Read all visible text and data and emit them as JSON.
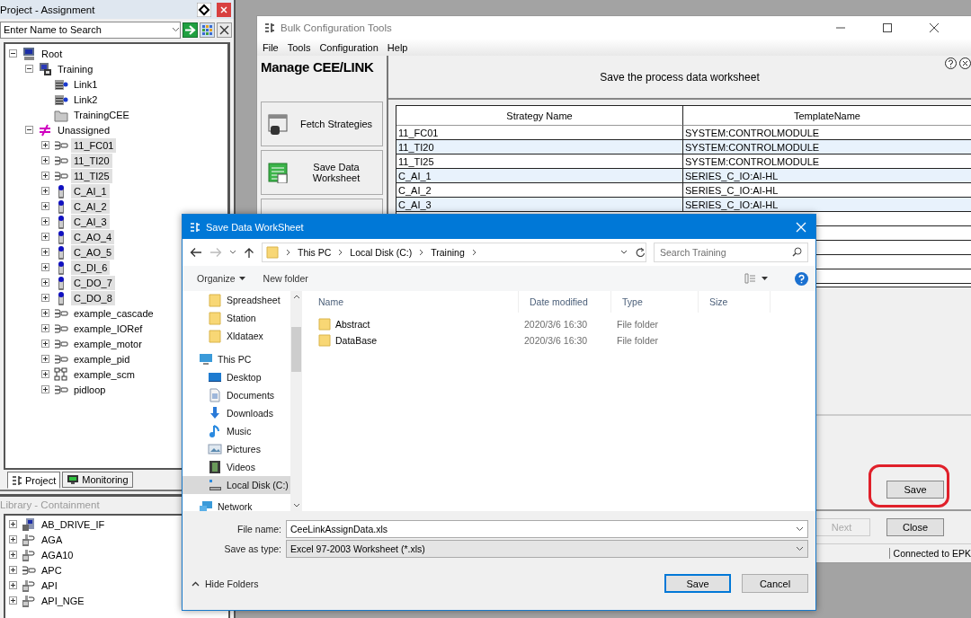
{
  "project_panel": {
    "title": "Project - Assignment",
    "search": {
      "value": "Enter Name to Search"
    },
    "tree": [
      {
        "label": "Root",
        "kind": "computer",
        "expanded": true,
        "selected": false,
        "children": [
          {
            "label": "Training",
            "kind": "controller",
            "expanded": true,
            "selected": false,
            "children": [
              {
                "label": "Link1",
                "kind": "link",
                "selected": false
              },
              {
                "label": "Link2",
                "kind": "link",
                "selected": false
              },
              {
                "label": "TrainingCEE",
                "kind": "folder",
                "selected": false
              }
            ]
          },
          {
            "label": "Unassigned",
            "kind": "unassigned",
            "expanded": true,
            "selected": false,
            "children": [
              {
                "label": "11_FC01",
                "kind": "module",
                "expanded": false,
                "selected": true
              },
              {
                "label": "11_TI20",
                "kind": "module",
                "expanded": false,
                "selected": true
              },
              {
                "label": "11_TI25",
                "kind": "module",
                "expanded": false,
                "selected": true
              },
              {
                "label": "C_AI_1",
                "kind": "io",
                "expanded": false,
                "selected": true
              },
              {
                "label": "C_AI_2",
                "kind": "io",
                "expanded": false,
                "selected": true
              },
              {
                "label": "C_AI_3",
                "kind": "io",
                "expanded": false,
                "selected": true
              },
              {
                "label": "C_AO_4",
                "kind": "io",
                "expanded": false,
                "selected": true
              },
              {
                "label": "C_AO_5",
                "kind": "io",
                "expanded": false,
                "selected": true
              },
              {
                "label": "C_DI_6",
                "kind": "io",
                "expanded": false,
                "selected": true
              },
              {
                "label": "C_DO_7",
                "kind": "io",
                "expanded": false,
                "selected": true
              },
              {
                "label": "C_DO_8",
                "kind": "io",
                "expanded": false,
                "selected": true
              },
              {
                "label": "example_cascade",
                "kind": "module",
                "expanded": false,
                "selected": false
              },
              {
                "label": "example_IORef",
                "kind": "module",
                "expanded": false,
                "selected": false
              },
              {
                "label": "example_motor",
                "kind": "module",
                "expanded": false,
                "selected": false
              },
              {
                "label": "example_pid",
                "kind": "module",
                "expanded": false,
                "selected": false
              },
              {
                "label": "example_scm",
                "kind": "scm",
                "expanded": false,
                "selected": false
              },
              {
                "label": "pidloop",
                "kind": "module",
                "expanded": false,
                "selected": false
              }
            ]
          }
        ]
      }
    ],
    "tabs": [
      {
        "label": "Project",
        "selected": true
      },
      {
        "label": "Monitoring",
        "selected": false
      }
    ]
  },
  "library_panel": {
    "title": "Library - Containment",
    "tree": [
      {
        "label": "AB_DRIVE_IF",
        "kind": "drive",
        "expanded": false,
        "selected": false
      },
      {
        "label": "AGA",
        "kind": "device",
        "expanded": false,
        "selected": false
      },
      {
        "label": "AGA10",
        "kind": "device",
        "expanded": false,
        "selected": false
      },
      {
        "label": "APC",
        "kind": "module",
        "expanded": false,
        "selected": false
      },
      {
        "label": "API",
        "kind": "device",
        "expanded": false,
        "selected": false
      },
      {
        "label": "API_NGE",
        "kind": "device",
        "expanded": false,
        "selected": false
      }
    ]
  },
  "bulk_window": {
    "title": "Bulk Configuration Tools",
    "menu": [
      "File",
      "Tools",
      "Configuration",
      "Help"
    ],
    "heading": "Manage CEE/LINK",
    "steps": [
      {
        "label": "Fetch Strategies",
        "kind": "fetch"
      },
      {
        "label": "Save Data Worksheet",
        "kind": "save"
      }
    ],
    "instruction": "Save the process data worksheet",
    "table": {
      "columns": [
        "Strategy Name",
        "TemplateName"
      ],
      "rows": [
        [
          "11_FC01",
          "SYSTEM:CONTROLMODULE"
        ],
        [
          "11_TI20",
          "SYSTEM:CONTROLMODULE"
        ],
        [
          "11_TI25",
          "SYSTEM:CONTROLMODULE"
        ],
        [
          "C_AI_1",
          "SERIES_C_IO:AI-HL"
        ],
        [
          "C_AI_2",
          "SERIES_C_IO:AI-HL"
        ],
        [
          "C_AI_3",
          "SERIES_C_IO:AI-HL"
        ]
      ]
    },
    "action_button": "Save",
    "buttons": [
      {
        "label": "Next",
        "disabled": true
      },
      {
        "label": "Close",
        "disabled": false
      }
    ],
    "status": "Connected to EPK"
  },
  "save_dialog": {
    "title": "Save Data WorkSheet",
    "breadcrumb": [
      "This PC",
      "Local Disk (C:)",
      "Training"
    ],
    "search": {
      "placeholder": "Search Training"
    },
    "toolbar": [
      "Organize",
      "New folder"
    ],
    "nav_pinned": [
      {
        "label": "Spreadsheet",
        "kind": "folder",
        "selected": false
      },
      {
        "label": "Station",
        "kind": "folder",
        "selected": false
      },
      {
        "label": "Xldataex",
        "kind": "folder",
        "selected": false
      }
    ],
    "nav": [
      {
        "label": "This PC",
        "kind": "pc",
        "selected": false,
        "children": [
          {
            "label": "Desktop",
            "kind": "desktop",
            "selected": false
          },
          {
            "label": "Documents",
            "kind": "documents",
            "selected": false
          },
          {
            "label": "Downloads",
            "kind": "downloads",
            "selected": false
          },
          {
            "label": "Music",
            "kind": "music",
            "selected": false
          },
          {
            "label": "Pictures",
            "kind": "pictures",
            "selected": false
          },
          {
            "label": "Videos",
            "kind": "videos",
            "selected": false
          },
          {
            "label": "Local Disk (C:)",
            "kind": "disk",
            "selected": true
          }
        ]
      },
      {
        "label": "Network",
        "kind": "network",
        "selected": false
      }
    ],
    "columns": [
      "Name",
      "Date modified",
      "Type",
      "Size"
    ],
    "files": [
      {
        "name": "Abstract",
        "date": "2020/3/6 16:30",
        "type": "File folder"
      },
      {
        "name": "DataBase",
        "date": "2020/3/6 16:30",
        "type": "File folder"
      }
    ],
    "file_name": {
      "label": "File name:",
      "value": "CeeLinkAssignData.xls"
    },
    "save_type": {
      "label": "Save as type:",
      "value": "Excel 97-2003 Worksheet (*.xls)"
    },
    "hide_folders": "Hide Folders",
    "buttons": [
      {
        "label": "Save",
        "default": true
      },
      {
        "label": "Cancel",
        "default": false
      }
    ]
  }
}
